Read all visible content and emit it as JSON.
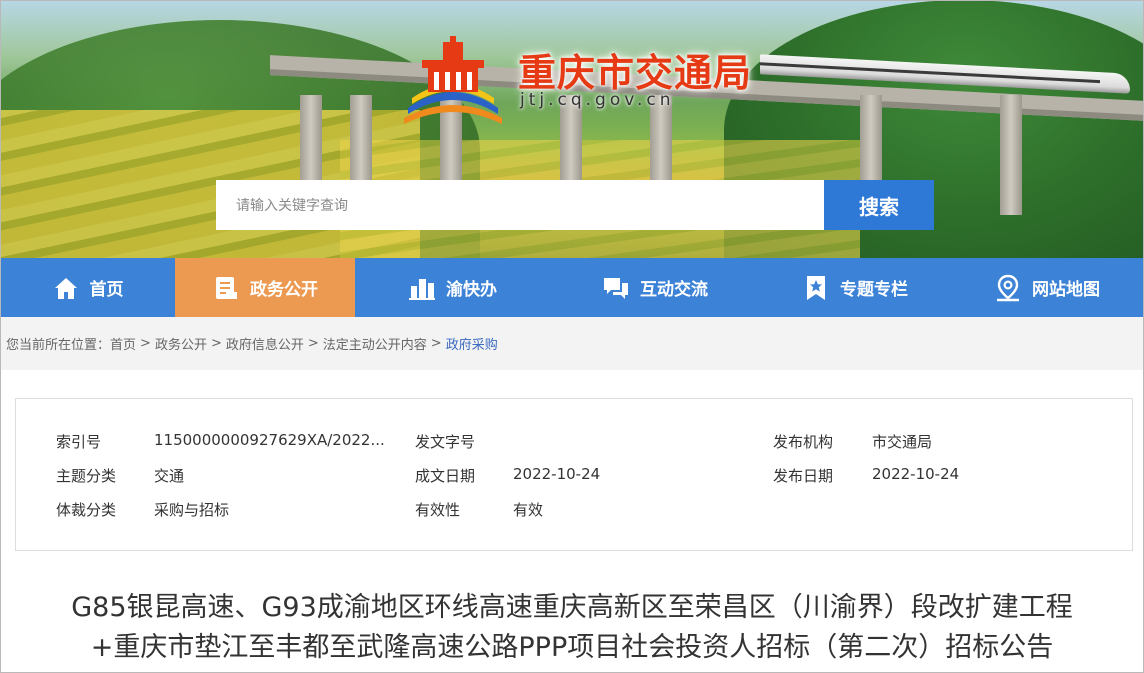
{
  "header": {
    "site_title": "重庆市交通局",
    "site_url": "jtj.cq.gov.cn",
    "logo_colors": {
      "red": "#e53a14",
      "orange": "#f08a1c",
      "yellow": "#f5c418",
      "blue": "#2a62c8"
    }
  },
  "search": {
    "placeholder": "请输入关键字查询",
    "button_label": "搜索"
  },
  "nav": {
    "items": [
      {
        "label": "首页",
        "icon": "home-icon"
      },
      {
        "label": "政务公开",
        "icon": "document-icon",
        "active": true
      },
      {
        "label": "渝快办",
        "icon": "buildings-icon"
      },
      {
        "label": "互动交流",
        "icon": "chat-icon"
      },
      {
        "label": "专题专栏",
        "icon": "star-bookmark-icon"
      },
      {
        "label": "网站地图",
        "icon": "map-pin-icon"
      }
    ],
    "colors": {
      "bar": "#3c82d7",
      "active": "#ec9a52"
    }
  },
  "breadcrumb": {
    "prefix": "您当前所在位置：",
    "items": [
      "首页",
      "政务公开",
      "政府信息公开",
      "法定主动公开内容",
      "政府采购"
    ],
    "separator": ">"
  },
  "info": {
    "index_label": "索引号",
    "index_value": "1150000000927629XA/2022...",
    "doc_no_label": "发文字号",
    "doc_no_value": "",
    "issuer_label": "发布机构",
    "issuer_value": "市交通局",
    "topic_label": "主题分类",
    "topic_value": "交通",
    "created_label": "成文日期",
    "created_value": "2022-10-24",
    "published_label": "发布日期",
    "published_value": "2022-10-24",
    "genre_label": "体裁分类",
    "genre_value": "采购与招标",
    "validity_label": "有效性",
    "validity_value": "有效"
  },
  "article": {
    "title_line1": "G85银昆高速、G93成渝地区环线高速重庆高新区至荣昌区（川渝界）段改扩建工程",
    "title_line2": "+重庆市垫江至丰都至武隆高速公路PPP项目社会投资人招标（第二次）招标公告"
  }
}
